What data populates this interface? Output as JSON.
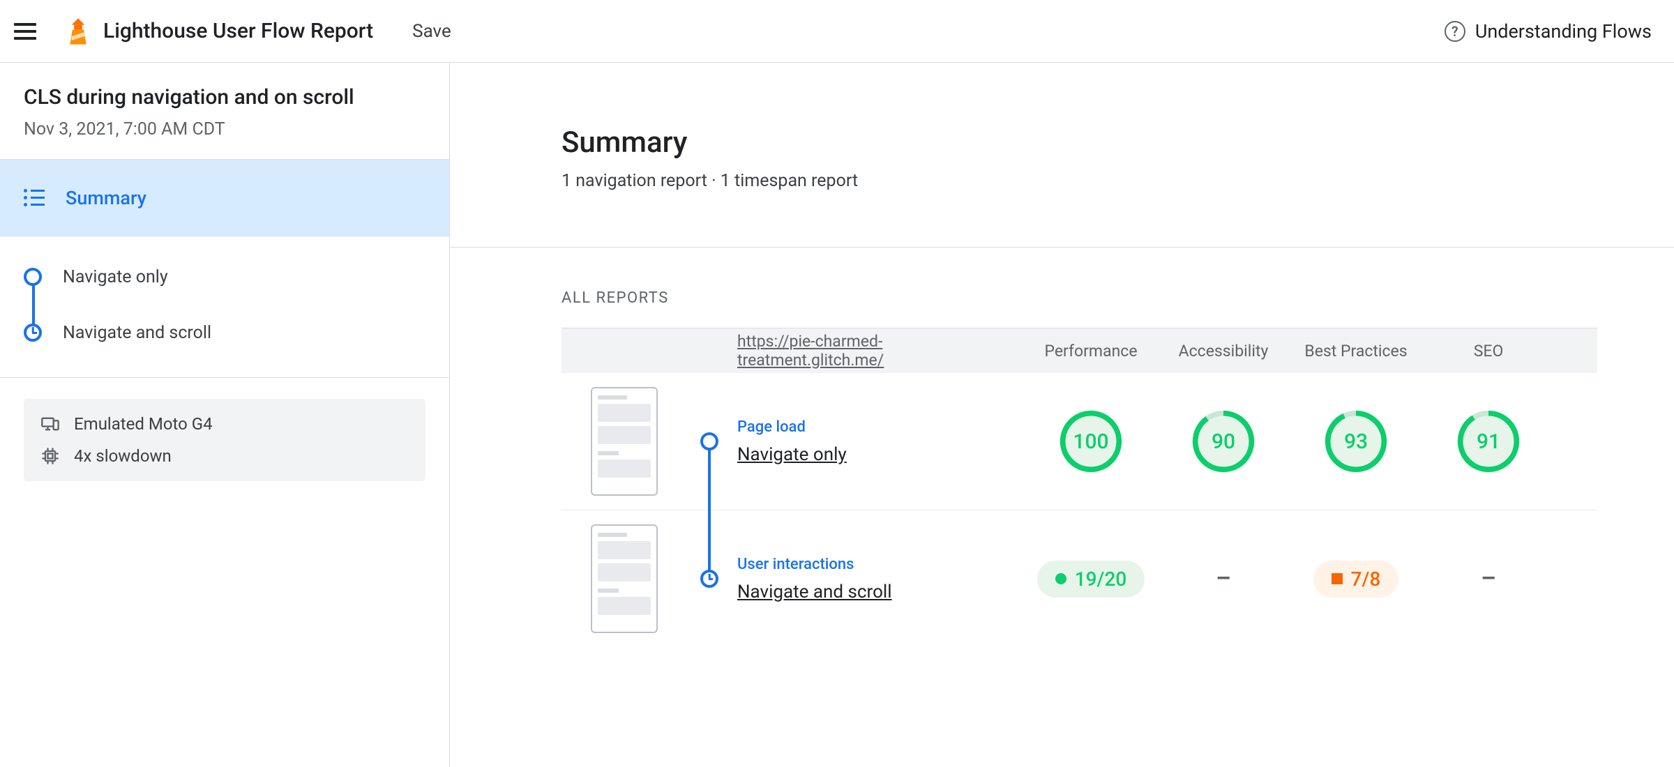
{
  "header": {
    "app_title": "Lighthouse User Flow Report",
    "save_label": "Save",
    "help_label": "Understanding Flows"
  },
  "sidebar": {
    "flow_title": "CLS during navigation and on scroll",
    "flow_date": "Nov 3, 2021, 7:00 AM CDT",
    "summary_label": "Summary",
    "steps": [
      {
        "label": "Navigate only",
        "marker": "circle"
      },
      {
        "label": "Navigate and scroll",
        "marker": "clock"
      }
    ],
    "env": {
      "device": "Emulated Moto G4",
      "throttle": "4x slowdown"
    }
  },
  "main": {
    "hero_title": "Summary",
    "hero_sub": "1 navigation report · 1 timespan report",
    "section_label": "ALL REPORTS",
    "table": {
      "url": "https://pie-charmed-treatment.glitch.me/",
      "columns": [
        "Performance",
        "Accessibility",
        "Best Practices",
        "SEO"
      ],
      "rows": [
        {
          "kind": "Page load",
          "name": "Navigate only",
          "marker": "circle",
          "cells": [
            {
              "type": "gauge",
              "value": 100
            },
            {
              "type": "gauge",
              "value": 90
            },
            {
              "type": "gauge",
              "value": 93
            },
            {
              "type": "gauge",
              "value": 91
            }
          ]
        },
        {
          "kind": "User interactions",
          "name": "Navigate and scroll",
          "marker": "clock",
          "cells": [
            {
              "type": "pill",
              "style": "green",
              "text": "19/20"
            },
            {
              "type": "dash"
            },
            {
              "type": "pill",
              "style": "orange",
              "text": "7/8"
            },
            {
              "type": "dash"
            }
          ]
        }
      ]
    }
  }
}
